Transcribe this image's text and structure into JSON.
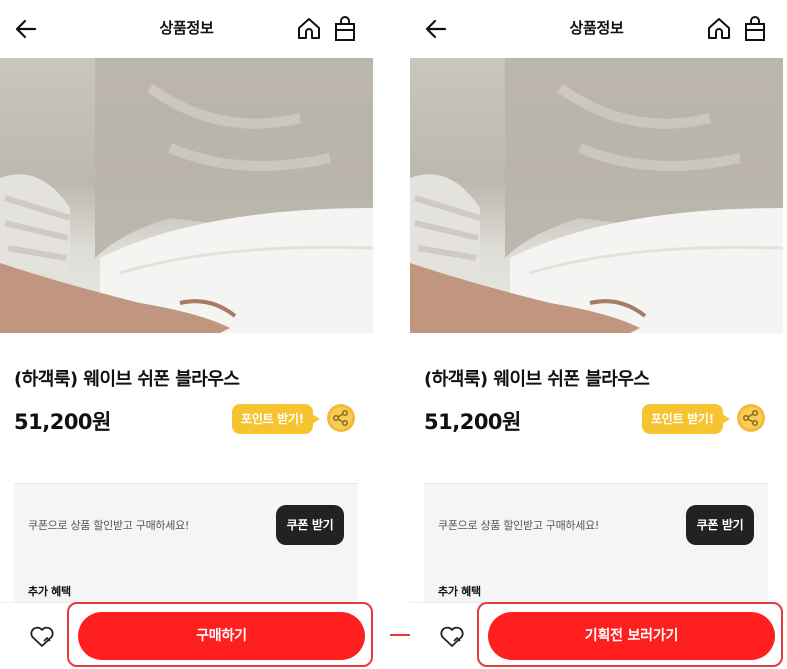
{
  "screens": [
    {
      "header": {
        "title": "상품정보",
        "back_icon": "back-arrow-icon",
        "home_icon": "home-icon",
        "bag_icon": "shopping-bag-icon"
      },
      "product": {
        "name": "(하객룩) 웨이브 쉬폰 블라우스",
        "price": "51,200원",
        "points_label": "포인트 받기!"
      },
      "coupon": {
        "text": "쿠폰으로 상품 할인받고 구매하세요!",
        "button": "쿠폰 받기"
      },
      "benefits": {
        "title": "추가 혜택"
      },
      "bottom_bar": {
        "wishlist_icon": "heart-icon",
        "cta": "구매하기"
      }
    },
    {
      "header": {
        "title": "상품정보",
        "back_icon": "back-arrow-icon",
        "home_icon": "home-icon",
        "bag_icon": "shopping-bag-icon"
      },
      "product": {
        "name": "(하객룩) 웨이브 쉬폰 블라우스",
        "price": "51,200원",
        "points_label": "포인트 받기!"
      },
      "coupon": {
        "text": "쿠폰으로 상품 할인받고 구매하세요!",
        "button": "쿠폰 받기"
      },
      "benefits": {
        "title": "추가 혜택"
      },
      "bottom_bar": {
        "wishlist_icon": "heart-icon",
        "cta": "기획전 보러가기"
      }
    }
  ],
  "colors": {
    "cta": "#ff1f1f",
    "points": "#f7c431",
    "highlight": "#e43d3d",
    "coupon_button": "#222222"
  }
}
